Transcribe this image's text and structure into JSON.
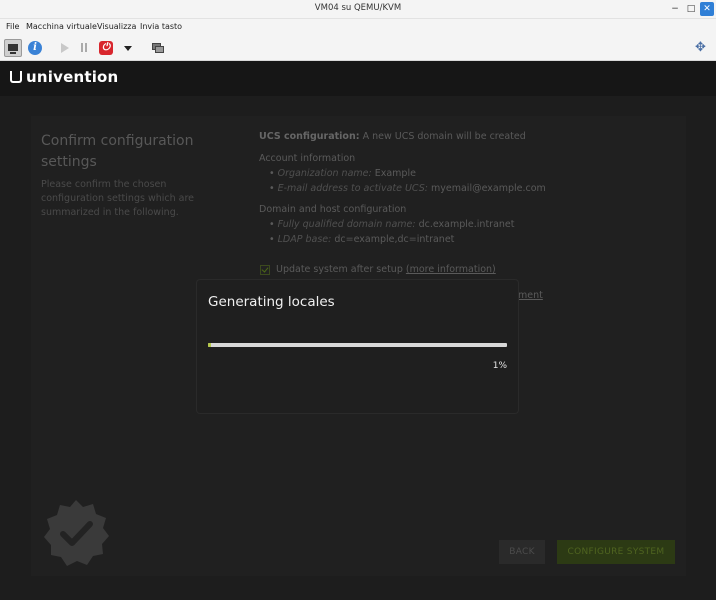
{
  "window": {
    "title": "VM04 su QEMU/KVM",
    "min_glyph": "−",
    "max_glyph": "□",
    "close_glyph": "✕"
  },
  "menu": [
    "File",
    "Macchina virtuale",
    "Visualizza",
    "Invia tasto"
  ],
  "toolbar": {
    "icons": [
      "monitor-icon",
      "info-icon",
      "play-icon",
      "pause-icon",
      "power-icon",
      "dropdown-icon",
      "screenshot-icon",
      "resize-icon"
    ],
    "info_glyph": "i",
    "power_glyph": "⏻",
    "resize_glyph": "✥"
  },
  "brand": {
    "name": "univention"
  },
  "page": {
    "heading": "Confirm configuration settings",
    "description": "Please confirm the chosen configuration settings which are summarized in the following.",
    "ucs_label": "UCS configuration:",
    "ucs_value": "A new UCS domain will be created",
    "account_header": "Account information",
    "org_label": "Organization name:",
    "org_value": "Example",
    "email_label": "E-mail address to activate UCS:",
    "email_value": "myemail@example.com",
    "domain_header": "Domain and host configuration",
    "fqdn_label": "Fully qualified domain name:",
    "fqdn_value": "dc.example.intranet",
    "ldap_label": "LDAP base:",
    "ldap_value": "dc=example,dc=intranet",
    "update_label": "Update system after setup",
    "more_info": "(more information)",
    "partial_link": "ment",
    "update_checked": true
  },
  "buttons": {
    "back": "BACK",
    "configure": "CONFIGURE SYSTEM"
  },
  "dialog": {
    "title": "Generating locales",
    "progress": 0.01,
    "progress_label": "1%"
  },
  "colors": {
    "accent": "#b6c94a",
    "brand_dark": "#161616"
  }
}
